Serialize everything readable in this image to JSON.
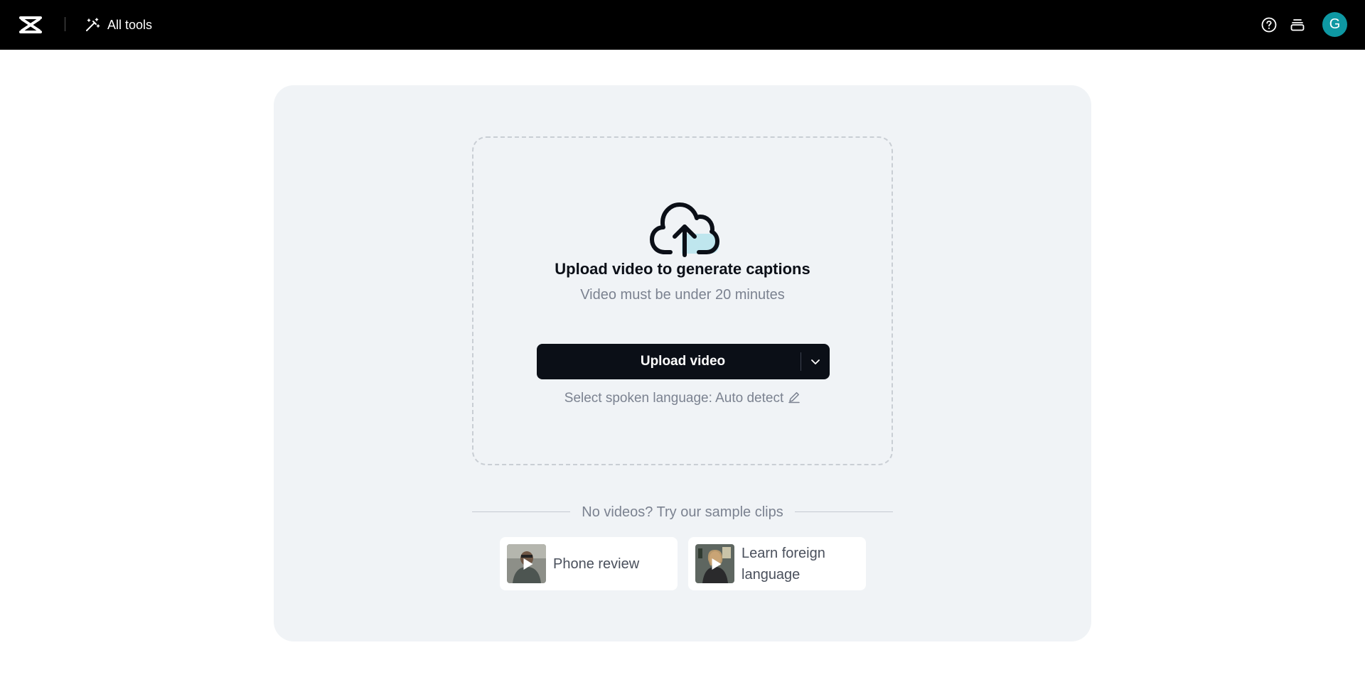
{
  "header": {
    "all_tools_label": "All tools",
    "avatar_initial": "G",
    "avatar_color": "#0e98a3"
  },
  "upload": {
    "title": "Upload video to generate captions",
    "subtitle": "Video must be under 20 minutes",
    "button_label": "Upload video",
    "language_text": "Select spoken language: Auto detect"
  },
  "samples": {
    "heading": "No videos? Try our sample clips",
    "clips": [
      {
        "label": "Phone review"
      },
      {
        "label": "Learn foreign language"
      }
    ]
  },
  "icons": [
    "capcut-logo-icon",
    "magic-wand-icon",
    "help-icon",
    "stack-icon",
    "cloud-upload-icon",
    "chevron-down-icon",
    "pencil-icon",
    "play-icon"
  ]
}
